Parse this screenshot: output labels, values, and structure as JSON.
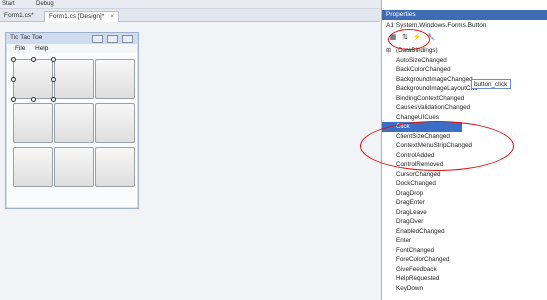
{
  "toolbar": {
    "start_label": "Start",
    "config": "Debug"
  },
  "tabs": [
    {
      "label": "Form1.cs*"
    },
    {
      "label": "Form1.cs [Design]*",
      "close": "×"
    }
  ],
  "form": {
    "title": "Tic Tac Toe",
    "menu": [
      "File",
      "Help"
    ],
    "grid_rows": 3,
    "grid_cols": 3
  },
  "properties": {
    "header": "Properties",
    "object": "A1  System.Windows.Forms.Button",
    "events": [
      "(DataBindings)",
      "AutoSizeChanged",
      "BackColorChanged",
      "BackgroundImageChanged",
      "BackgroundImageLayoutChc",
      "BindingContextChanged",
      "CausesValidationChanged",
      "ChangeUICues",
      "Click",
      "ClientSizeChanged",
      "ContextMenuStripChanged",
      "ControlAdded",
      "ControlRemoved",
      "CursorChanged",
      "DockChanged",
      "DragDrop",
      "DragEnter",
      "DragLeave",
      "DragOver",
      "EnabledChanged",
      "Enter",
      "FontChanged",
      "ForeColorChanged",
      "GiveFeedback",
      "HelpRequested",
      "KeyDown"
    ],
    "selected_event": "Click",
    "click_handler": "button_click"
  },
  "colors": {
    "accent": "#3f6bb5",
    "annotation": "#e01010"
  }
}
